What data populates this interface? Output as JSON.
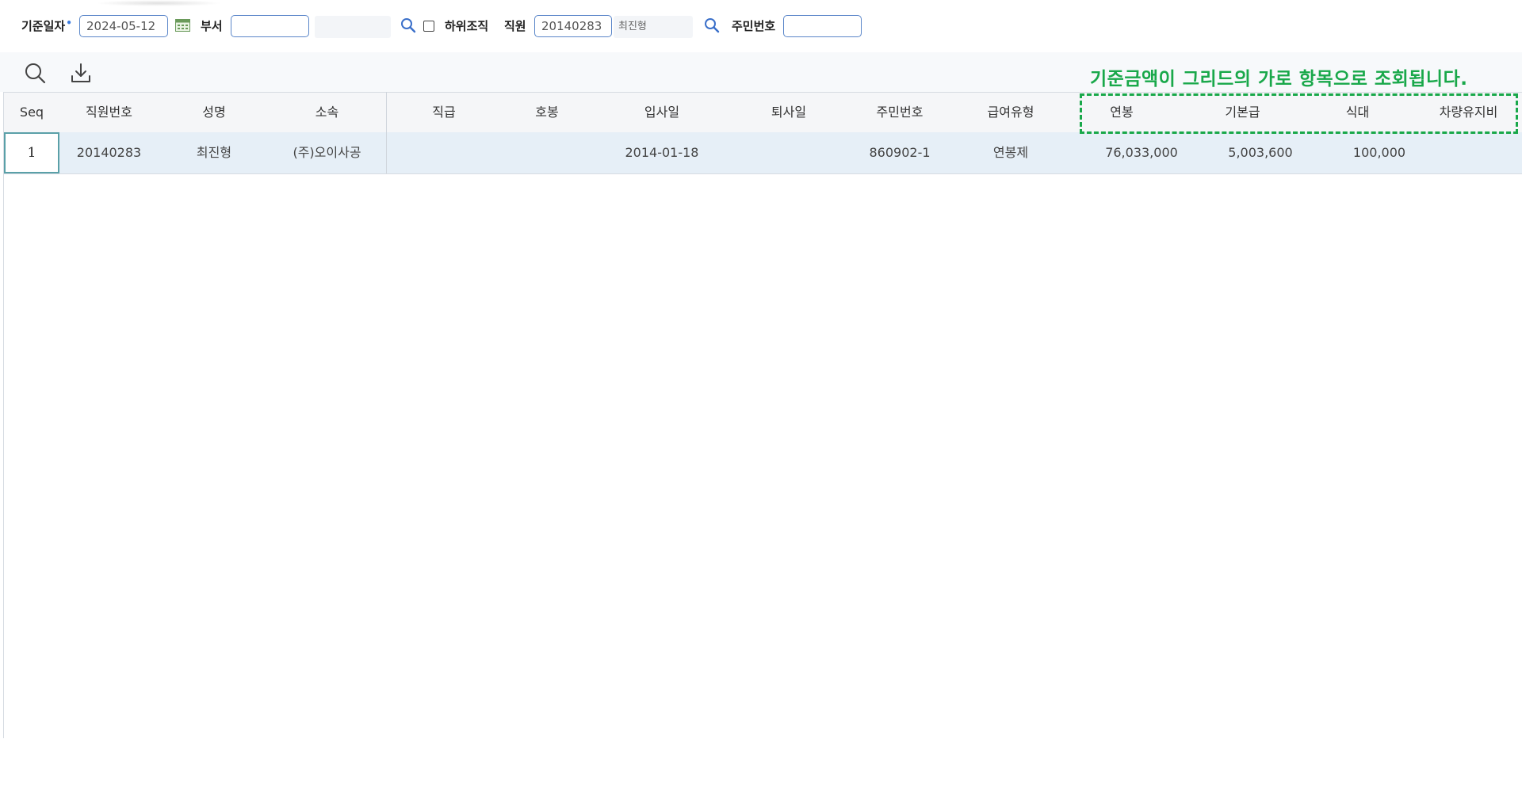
{
  "filter": {
    "base_date_label": "기준일자",
    "required_mark": "•",
    "base_date_value": "2024-05-12",
    "dept_label": "부서",
    "dept_code_value": "",
    "dept_name_value": "",
    "sub_org_label": "하위조직",
    "sub_org_checked": false,
    "employee_label": "직원",
    "employee_id_value": "20140283",
    "employee_name_value": "최진형",
    "resident_no_label": "주민번호",
    "resident_no_value": ""
  },
  "annotation": {
    "text": "기준금액이 그리드의 가로 항목으로 조회됩니다.",
    "color": "#19a84a"
  },
  "grid": {
    "columns": [
      "Seq",
      "직원번호",
      "성명",
      "소속",
      "직급",
      "호봉",
      "입사일",
      "퇴사일",
      "주민번호",
      "급여유형",
      "연봉",
      "기본급",
      "식대",
      "차량유지비"
    ],
    "rows": [
      {
        "seq": "1",
        "emp_no": "20140283",
        "name": "최진형",
        "affiliation": "(주)오이사공",
        "grade": "",
        "step": "",
        "hire_date": "2014-01-18",
        "resign_date": "",
        "resident_no": "860902-1",
        "pay_type": "연봉제",
        "annual_salary": "76,033,000",
        "base_pay": "5,003,600",
        "meal": "100,000",
        "vehicle": ""
      }
    ]
  },
  "colors": {
    "input_border": "#5a86c9",
    "selected_row": "#e6eff7",
    "header_bg": "#f5f6f8",
    "highlight_green": "#19a84a"
  }
}
